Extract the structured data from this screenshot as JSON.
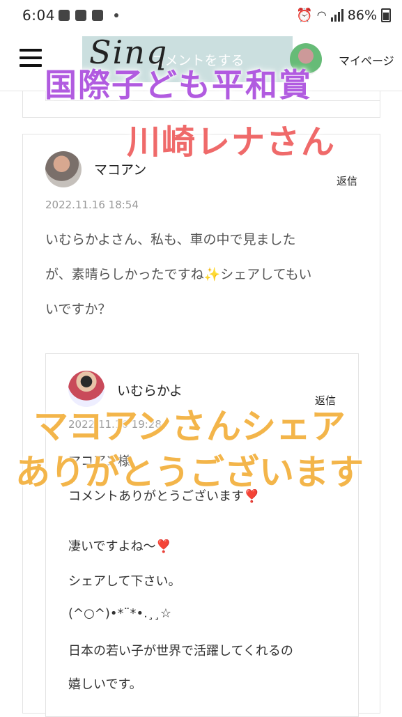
{
  "status_bar": {
    "time": "6:04",
    "battery": "86%"
  },
  "header": {
    "logo": "Sinq",
    "comment_button": "コメントをする",
    "mypage_label": "マイページ"
  },
  "comment": {
    "author": "マコアン",
    "reply_label": "返信",
    "timestamp": "2022.11.16 18:54",
    "text": "いむらかよさん、私も、車の中で見ました\nが、素晴らしかったですね✨シェアしてもい\nいですか？"
  },
  "reply": {
    "author": "いむらかよ",
    "reply_label": "返信",
    "timestamp": "2022.11.16 19:28",
    "lines": [
      "マコアン様",
      "コメントありがとうございます❣️",
      "凄いですよね〜❣️",
      "シェアして下さい。",
      "(^○^)•*¨*•.¸¸☆",
      "日本の若い子が世界で活躍してくれるの",
      "嬉しいです。"
    ]
  },
  "overlay": {
    "title": "国際子ども平和賞",
    "name": "川崎レナさん",
    "line1": "マコアンさんシェア",
    "line2": "ありがとうございます"
  },
  "colors": {
    "overlay_title": "#b15be0",
    "overlay_name": "#ef6a6a",
    "overlay_caption": "#f3b54a",
    "comment_button_bg": "#a0c4c4"
  }
}
